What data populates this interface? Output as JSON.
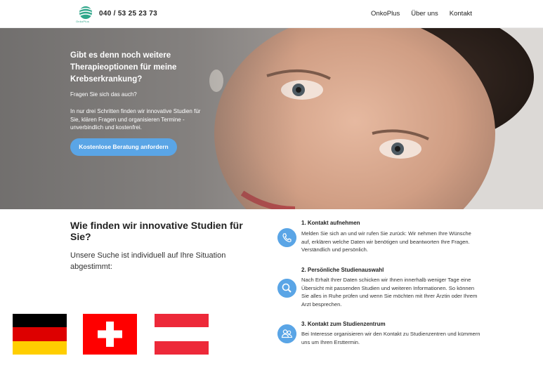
{
  "header": {
    "logo_text": "OnkoPlus",
    "phone": "040 / 53 25 23 73",
    "nav": [
      "OnkoPlus",
      "Über uns",
      "Kontakt"
    ]
  },
  "hero": {
    "title": "Gibt es denn noch weitere Therapieoptionen für meine Krebserkrankung?",
    "question": "Fragen Sie sich das auch?",
    "text": "In nur drei Schritten finden wir innovative Studien für Sie, klären Fragen und organisieren Termine - unverbindlich und kostenfrei.",
    "button": "Kostenlose Beratung anfordern"
  },
  "section": {
    "title": "Wie finden wir innovative Studien für Sie?",
    "subtitle": "Unsere Suche ist individuell auf Ihre Situation abgestimmt:"
  },
  "steps": [
    {
      "icon": "phone-icon",
      "title": "1. Kontakt aufnehmen",
      "text": "Melden Sie sich an und wir rufen Sie zurück: Wir nehmen Ihre Wünsche auf, erklären welche Daten wir benötigen und beantworten Ihre Fragen. Verständlich und persönlich."
    },
    {
      "icon": "search-icon",
      "title": "2. Persönliche Studienauswahl",
      "text": "Nach Erhalt Ihrer Daten schicken wir Ihnen innerhalb weniger Tage eine Übersicht mit passenden Studien und weiteren Informationen. So können Sie alles in Ruhe prüfen und wenn Sie möchten mit Ihrer Ärztin oder Ihrem Arzt besprechen."
    },
    {
      "icon": "people-icon",
      "title": "3. Kontakt zum Studienzentrum",
      "text": "Bei Interesse organisieren wir den Kontakt zu Studienzentren und kümmern uns um Ihren Ersttermin."
    }
  ],
  "colors": {
    "accent": "#5aa5e6",
    "logo": "#2fa68a",
    "flag_black": "#000000",
    "flag_red": "#dd0000",
    "flag_gold": "#ffce00",
    "swiss_red": "#ff0000",
    "austria_red": "#ed2939"
  }
}
